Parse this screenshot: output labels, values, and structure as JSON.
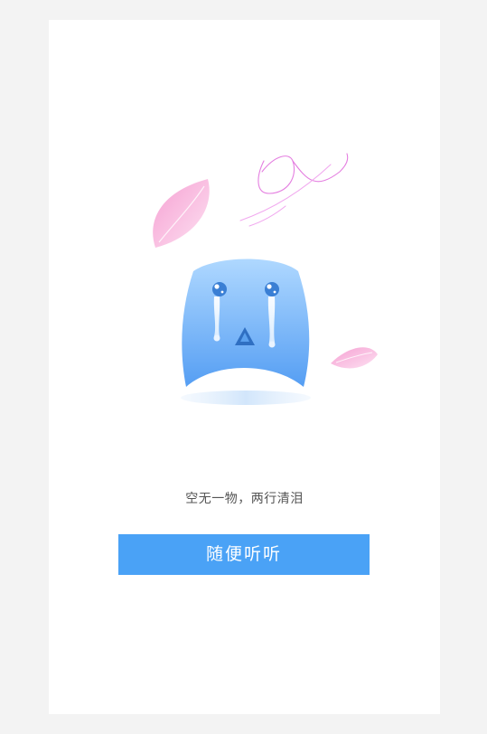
{
  "empty_state": {
    "message": "空无一物，两行清泪",
    "button_label": "随便听听"
  },
  "colors": {
    "accent": "#4aa2f6",
    "mascot_top": "#a8d4ff",
    "mascot_bottom": "#5aa6f5",
    "petal": "#f7a6d6"
  },
  "icons": {
    "mascot": "crying-mascot-icon",
    "petal": "petal-icon",
    "wind": "wind-lines-icon"
  }
}
